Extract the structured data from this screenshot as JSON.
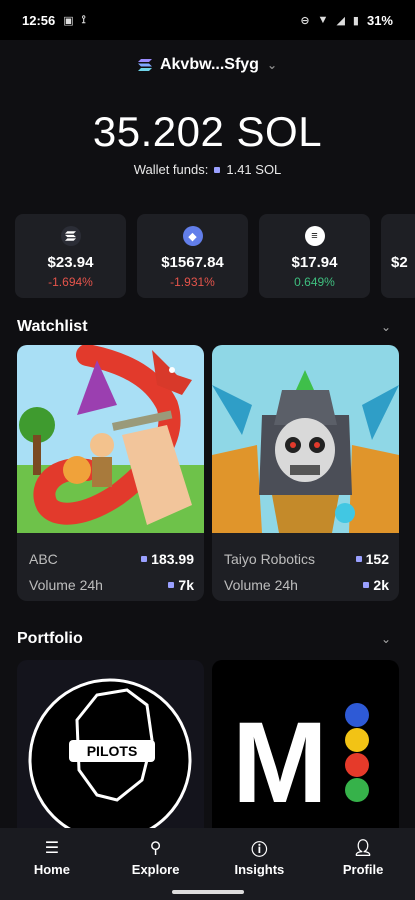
{
  "status_bar": {
    "time": "12:56",
    "battery": "31%"
  },
  "wallet": {
    "name": "Akvbw...Sfyg"
  },
  "balance": {
    "amount": "35.202 SOL",
    "funds_label": "Wallet funds:",
    "funds_value": "1.41 SOL"
  },
  "tokens": [
    {
      "icon": "solana-icon",
      "price": "$23.94",
      "change": "-1.694%",
      "direction": "down"
    },
    {
      "icon": "ethereum-icon",
      "price": "$1567.84",
      "change": "-1.931%",
      "direction": "down"
    },
    {
      "icon": "token-icon",
      "price": "$17.94",
      "change": "0.649%",
      "direction": "up"
    },
    {
      "icon": "token-icon",
      "price": "$2",
      "change": "",
      "direction": ""
    }
  ],
  "watchlist": {
    "title": "Watchlist",
    "items": [
      {
        "name": "ABC",
        "price": "183.99",
        "volume_label": "Volume 24h",
        "volume": "7k"
      },
      {
        "name": "Taiyo Robotics",
        "price": "152",
        "volume_label": "Volume 24h",
        "volume": "2k"
      }
    ]
  },
  "portfolio": {
    "title": "Portfolio",
    "items": [
      {
        "logo_text": "PILOTS"
      },
      {
        "logo_text": "M"
      }
    ]
  },
  "nav": [
    {
      "label": "Home",
      "icon": "list-icon"
    },
    {
      "label": "Explore",
      "icon": "search-icon"
    },
    {
      "label": "Insights",
      "icon": "info-icon"
    },
    {
      "label": "Profile",
      "icon": "person-icon"
    }
  ],
  "colors": {
    "negative": "#e5544b",
    "positive": "#3fbf7f",
    "card_bg": "#1e1f24"
  }
}
